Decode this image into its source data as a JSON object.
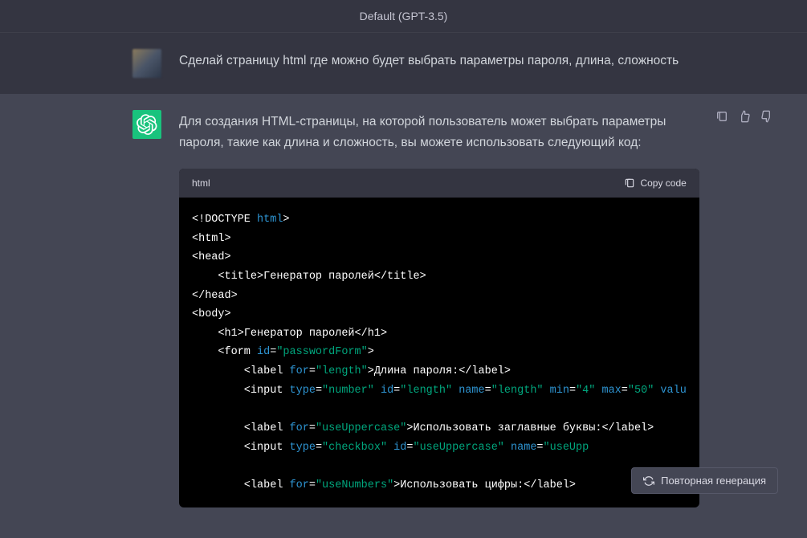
{
  "header": {
    "model": "Default (GPT-3.5)"
  },
  "user_message": "Сделай страницу html где можно будет выбрать параметры пароля, длина, сложность",
  "assistant_message": "Для создания HTML-страницы, на которой пользователь может выбрать параметры пароля, такие как длина и сложность, вы можете использовать следующий код:",
  "code": {
    "lang": "html",
    "copy_label": "Copy code",
    "content": {
      "doctype": "<!DOCTYPE ",
      "doctype_kw": "html",
      "doctype_end": ">",
      "html_open": "<html>",
      "head_open": "<head>",
      "title_open": "    <title>",
      "title_text": "Генератор паролей",
      "title_close": "</title>",
      "head_close": "</head>",
      "body_open": "<body>",
      "h1_open": "    <h1>",
      "h1_text": "Генератор паролей",
      "h1_close": "</h1>",
      "form_open1": "    <form ",
      "form_id_attr": "id",
      "form_eq": "=",
      "form_id_val": "\"passwordForm\"",
      "form_open2": ">",
      "label1_open1": "        <label ",
      "label1_for_attr": "for",
      "label1_for_val": "\"length\"",
      "label1_open2": ">",
      "label1_text": "Длина пароля:",
      "label1_close": "</label>",
      "input1_open": "        <input ",
      "type_attr": "type",
      "input1_type_val": "\"number\"",
      "id_attr": "id",
      "input1_id_val": "\"length\"",
      "name_attr": "name",
      "input1_name_val": "\"length\"",
      "min_attr": "min",
      "input1_min_val": "\"4\"",
      "max_attr": "max",
      "input1_max_val": "\"50\"",
      "valu_attr": "valu",
      "label2_open1": "        <label ",
      "label2_for_val": "\"useUppercase\"",
      "label2_open2": ">",
      "label2_text": "Использовать заглавные буквы:",
      "label2_close": "</label>",
      "input2_open": "        <input ",
      "input2_type_val": "\"checkbox\"",
      "input2_id_val": "\"useUppercase\"",
      "input2_name_val": "\"useUpp",
      "label3_open1": "        <label ",
      "label3_for_val": "\"useNumbers\"",
      "label3_open2": ">",
      "label3_text": "Использовать цифры:",
      "label3_close": "</label>"
    }
  },
  "regenerate_label": "Повторная генерация"
}
